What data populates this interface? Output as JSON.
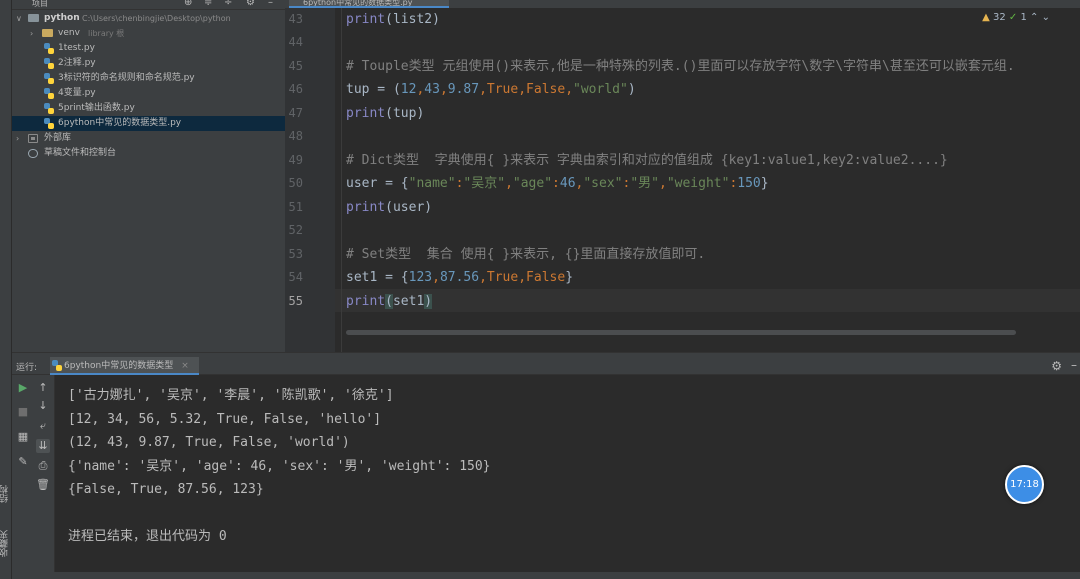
{
  "left_strip": {
    "labels": [
      "结构",
      "收藏夹"
    ]
  },
  "project": {
    "title": "项目",
    "root_name": "python",
    "root_path": "C:\\Users\\chenbingjie\\Desktop\\python",
    "venv_name": "venv",
    "venv_note": "library 根",
    "files": [
      "1test.py",
      "2注释.py",
      "3标识符的命名规则和命名规范.py",
      "4变量.py",
      "5print输出函数.py",
      "6python中常见的数据类型.py"
    ],
    "external_libs": "外部库",
    "scratches": "草稿文件和控制台"
  },
  "editor": {
    "tab_label": "6python中常见的数据类型.py",
    "inspection": {
      "warn_count": "32",
      "ok_count": "1"
    },
    "line_numbers": [
      "43",
      "44",
      "45",
      "46",
      "47",
      "48",
      "49",
      "50",
      "51",
      "52",
      "53",
      "54",
      "55"
    ],
    "lines": {
      "l43": {
        "fn": "print",
        "rest": "(list2)"
      },
      "l45": {
        "comment": "# Touple类型 元组使用()来表示,他是一种特殊的列表.()里面可以存放字符\\数字\\字符串\\甚至还可以嵌套元组."
      },
      "l46": {
        "var": "tup = (",
        "n1": "12",
        "n2": "43",
        "n3": "9.87",
        "b1": "True",
        "b2": "False",
        "s1": "\"world\"",
        "end": ")"
      },
      "l47": {
        "fn": "print",
        "rest": "(tup)"
      },
      "l49": {
        "comment": "# Dict类型  字典使用{ }来表示 字典由索引和对应的值组成 {key1:value1,key2:value2....}"
      },
      "l50": {
        "var": "user = {",
        "k1": "\"name\"",
        "v1": "\"吴京\"",
        "k2": "\"age\"",
        "v2": "46",
        "k3": "\"sex\"",
        "v3": "\"男\"",
        "k4": "\"weight\"",
        "v4": "150",
        "end": "}"
      },
      "l51": {
        "fn": "print",
        "rest": "(user)"
      },
      "l53": {
        "comment": "# Set类型  集合 使用{ }来表示, {}里面直接存放值即可."
      },
      "l54": {
        "var": "set1 = {",
        "n1": "123",
        "n2": "87.56",
        "b1": "True",
        "b2": "False",
        "end": "}"
      },
      "l55": {
        "fn": "print",
        "open": "(",
        "arg": "set1",
        "close": ")"
      }
    }
  },
  "run_panel": {
    "label": "运行:",
    "tab_label": "6python中常见的数据类型",
    "output": [
      "['古力娜扎', '吴京', '李晨', '陈凯歌', '徐克']",
      "[12, 34, 56, 5.32, True, False, 'hello']",
      "(12, 43, 9.87, True, False, 'world')",
      "{'name': '吴京', 'age': 46, 'sex': '男', 'weight': 150}",
      "{False, True, 87.56, 123}",
      "",
      "进程已结束，退出代码为 0"
    ]
  },
  "overlay": {
    "timer": "17:18"
  },
  "colors": {
    "keyword": "#cc7832",
    "string": "#6a8759",
    "number": "#6897bb",
    "comment": "#808080",
    "builtin": "#8888c6",
    "timer_bg": "#3d8ee6"
  }
}
